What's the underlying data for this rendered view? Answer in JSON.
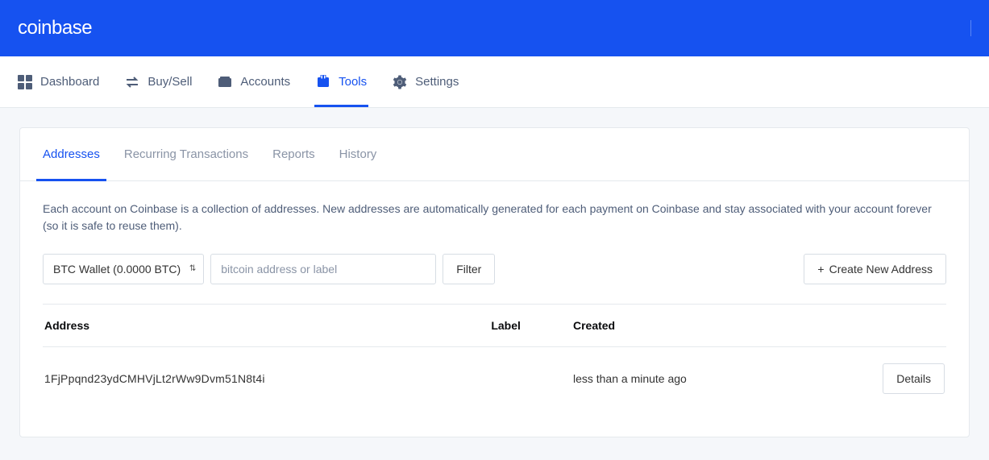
{
  "brand": "coinbase",
  "topnav": [
    {
      "key": "dashboard",
      "label": "Dashboard",
      "active": false
    },
    {
      "key": "buysell",
      "label": "Buy/Sell",
      "active": false
    },
    {
      "key": "accounts",
      "label": "Accounts",
      "active": false
    },
    {
      "key": "tools",
      "label": "Tools",
      "active": true
    },
    {
      "key": "settings",
      "label": "Settings",
      "active": false
    }
  ],
  "subtabs": [
    {
      "key": "addresses",
      "label": "Addresses",
      "active": true
    },
    {
      "key": "recurring",
      "label": "Recurring Transactions",
      "active": false
    },
    {
      "key": "reports",
      "label": "Reports",
      "active": false
    },
    {
      "key": "history",
      "label": "History",
      "active": false
    }
  ],
  "addresses": {
    "description": "Each account on Coinbase is a collection of addresses. New addresses are automatically generated for each payment on Coinbase and stay associated with your account forever (so it is safe to reuse them).",
    "wallet_select": "BTC Wallet (0.0000 BTC)",
    "search_placeholder": "bitcoin address or label",
    "filter_label": "Filter",
    "create_label": "Create New Address",
    "columns": {
      "address": "Address",
      "label": "Label",
      "created": "Created"
    },
    "rows": [
      {
        "address": "1FjPpqnd23ydCMHVjLt2rWw9Dvm51N8t4i",
        "label": "",
        "created": "less than a minute ago",
        "action": "Details"
      }
    ]
  }
}
